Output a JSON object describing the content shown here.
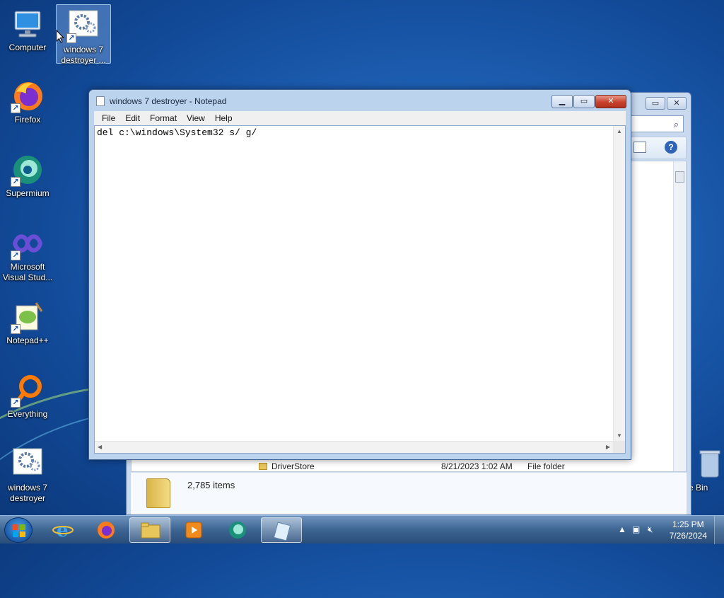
{
  "desktop": {
    "icons": [
      {
        "label": "Computer"
      },
      {
        "label": "windows 7 destroyer ..."
      },
      {
        "label": "Firefox"
      },
      {
        "label": "Supermium"
      },
      {
        "label": "Microsoft Visual Stud..."
      },
      {
        "label": "Notepad++"
      },
      {
        "label": "Everything"
      },
      {
        "label": "windows 7 destroyer"
      },
      {
        "label": "e Bin"
      }
    ]
  },
  "notepad": {
    "title": "windows 7 destroyer - Notepad",
    "menu": [
      "File",
      "Edit",
      "Format",
      "View",
      "Help"
    ],
    "content": "del c:\\windows\\System32 s/ g/",
    "controls": {
      "minimize": "▁",
      "maximize": "▭",
      "close": "✕"
    }
  },
  "explorer": {
    "row": {
      "name": "DriverStore",
      "date": "8/21/2023 1:02 AM",
      "type": "File folder"
    },
    "item_count": "2,785 items",
    "help_label": "?"
  },
  "taskbar": {
    "apps": [
      "internet-explorer-icon",
      "firefox-icon",
      "file-explorer-icon",
      "media-player-icon",
      "supermium-icon",
      "notepad-icon"
    ],
    "clock": {
      "time": "1:25 PM",
      "date": "7/26/2024"
    }
  },
  "colors": {
    "accent": "#1e5fb3",
    "close": "#c8412c"
  }
}
